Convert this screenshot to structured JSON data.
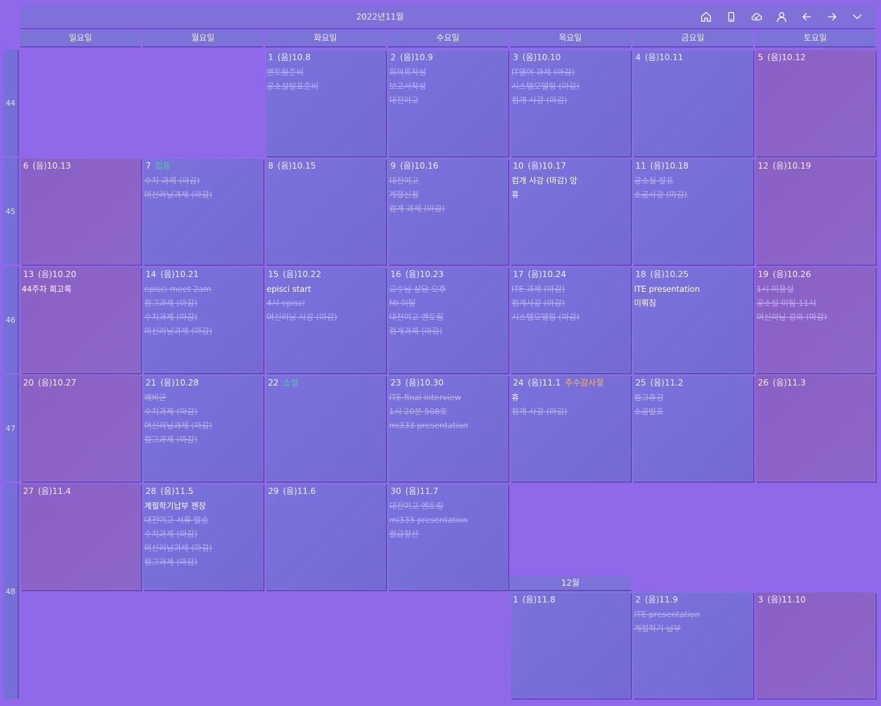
{
  "title": "2022년11월",
  "toolbar": [
    "home-icon",
    "phone-icon",
    "cloud-sync-icon",
    "user-icon",
    "arrow-left-icon",
    "arrow-right-icon",
    "chevron-down-icon"
  ],
  "weekdays": [
    "일요일",
    "월요일",
    "화요일",
    "수요일",
    "목요일",
    "금요일",
    "토요일"
  ],
  "weeks": [
    "44",
    "45",
    "46",
    "47",
    "48"
  ],
  "next_month_label": "12월",
  "nov": [
    {
      "d": "1",
      "l": "(음)10.8",
      "ev": [
        [
          "멘토링준비",
          1
        ],
        [
          "공소실발표준비",
          1
        ]
      ]
    },
    {
      "d": "2",
      "l": "(음)10.9",
      "ev": [
        [
          "회의록작성",
          1
        ],
        [
          "보고서작성",
          1
        ],
        [
          "대전여고",
          1
        ]
      ]
    },
    {
      "d": "3",
      "l": "(음)10.10",
      "ev": [
        [
          "IT영어 과제 (마감)",
          1
        ],
        [
          "시스템모델링 (마감)",
          1
        ],
        [
          "컴개 사강 (마감)",
          1
        ]
      ]
    },
    {
      "d": "4",
      "l": "(음)10.11",
      "ev": []
    },
    {
      "d": "5",
      "l": "(음)10.12",
      "ev": []
    },
    {
      "d": "6",
      "l": "(음)10.13",
      "ev": []
    },
    {
      "d": "7",
      "l": "",
      "h": "입동",
      "ev": [
        [
          "수치 과제 (마감)",
          1
        ],
        [
          "머신러닝과제 (마감)",
          1
        ]
      ]
    },
    {
      "d": "8",
      "l": "(음)10.15",
      "ev": []
    },
    {
      "d": "9",
      "l": "(음)10.16",
      "ev": [
        [
          "대전여고",
          1
        ],
        [
          "계절신청",
          1
        ],
        [
          "컴개 과제 (마감)",
          1
        ]
      ]
    },
    {
      "d": "10",
      "l": "(음)10.17",
      "ev": [
        [
          "컴개 사강 (마감) 망",
          0
        ],
        [
          "휴",
          0
        ]
      ]
    },
    {
      "d": "11",
      "l": "(음)10.18",
      "ev": [
        [
          "공소실 발표",
          1
        ],
        [
          "소공사강 (마감)",
          1
        ]
      ]
    },
    {
      "d": "12",
      "l": "(음)10.19",
      "ev": []
    },
    {
      "d": "13",
      "l": "(음)10.20",
      "ev": [
        [
          "44주차 회고록",
          0
        ]
      ]
    },
    {
      "d": "14",
      "l": "(음)10.21",
      "ev": [
        [
          "episci meet 2am",
          1
        ],
        [
          "컴그과제 (마감)",
          1
        ],
        [
          "수치과제 (마감)",
          1
        ],
        [
          "머신러닝과제 (마감)",
          1
        ]
      ]
    },
    {
      "d": "15",
      "l": "(음)10.22",
      "ev": [
        [
          "episci start",
          0
        ],
        [
          "4시 episci",
          1
        ],
        [
          "머신러닝 사강 (마감)",
          1
        ]
      ]
    },
    {
      "d": "16",
      "l": "(음)10.23",
      "ev": [
        [
          "교수님 상담 오후",
          1
        ],
        [
          "MI 미팅",
          1
        ],
        [
          "대전여고 멘토링",
          1
        ],
        [
          "컴개과제 (마감)",
          1
        ]
      ]
    },
    {
      "d": "17",
      "l": "(음)10.24",
      "ev": [
        [
          "ITE 과제 (마감)",
          1
        ],
        [
          "컴개사강 (마감)",
          1
        ],
        [
          "시스템모델링 (마감)",
          1
        ]
      ]
    },
    {
      "d": "18",
      "l": "(음)10.25",
      "ev": [
        [
          "ITE presentation",
          0
        ],
        [
          "미뤄짐",
          0
        ]
      ]
    },
    {
      "d": "19",
      "l": "(음)10.26",
      "ev": [
        [
          "1시 미용실",
          1
        ],
        [
          "공소실 미팅 11시",
          1
        ],
        [
          "머신러닝 강의 (마감)",
          1
        ]
      ]
    },
    {
      "d": "20",
      "l": "(음)10.27",
      "ev": []
    },
    {
      "d": "21",
      "l": "(음)10.28",
      "ev": [
        [
          "예비군",
          1
        ],
        [
          "수치과제 (마감)",
          1
        ],
        [
          "머신러닝과제 (마감)",
          1
        ],
        [
          "컴그과제 (마감)",
          1
        ]
      ]
    },
    {
      "d": "22",
      "l": "",
      "h": "소설",
      "ev": []
    },
    {
      "d": "23",
      "l": "(음)10.30",
      "ev": [
        [
          "ITE final interview",
          1
        ],
        [
          "1시 20분 508호",
          1
        ],
        [
          "mi333 presentation",
          1
        ]
      ]
    },
    {
      "d": "24",
      "l": "(음)11.1",
      "h": "추수감사절",
      "ev": [
        [
          "휴",
          0
        ],
        [
          "컴개 사강 (마감)",
          1
        ]
      ]
    },
    {
      "d": "25",
      "l": "(음)11.2",
      "ev": [
        [
          "컴그휴강",
          1
        ],
        [
          "소공발표",
          1
        ]
      ]
    },
    {
      "d": "26",
      "l": "(음)11.3",
      "ev": []
    },
    {
      "d": "27",
      "l": "(음)11.4",
      "ev": []
    },
    {
      "d": "28",
      "l": "(음)11.5",
      "ev": [
        [
          "계절학기납부 젠장",
          0
        ],
        [
          "대전여고 서류 발송",
          1
        ],
        [
          "수치과제 (마감)",
          1
        ],
        [
          "머신러닝과제 (마감)",
          1
        ],
        [
          "컴그과제 (마감)",
          1
        ]
      ]
    },
    {
      "d": "29",
      "l": "(음)11.6",
      "ev": []
    },
    {
      "d": "30",
      "l": "(음)11.7",
      "ev": [
        [
          "대전여고 멘토링",
          1
        ],
        [
          "mi333 presentation",
          1
        ],
        [
          "월급정산",
          1
        ]
      ]
    }
  ],
  "dec": [
    {
      "d": "1",
      "l": "(음)11.8",
      "ev": []
    },
    {
      "d": "2",
      "l": "(음)11.9",
      "ev": [
        [
          "ITE presentation",
          1
        ],
        [
          "계절학기 납부",
          1
        ]
      ]
    },
    {
      "d": "3",
      "l": "(음)11.10",
      "ev": []
    }
  ],
  "colors": {
    "background": "#8f69ea",
    "cell": "#7a72dc",
    "weekend_cell": "#8a60c4",
    "holiday_green": "#4fd0a0",
    "holiday_gold": "#ffb84a",
    "done_text": "#b8b1ee"
  }
}
